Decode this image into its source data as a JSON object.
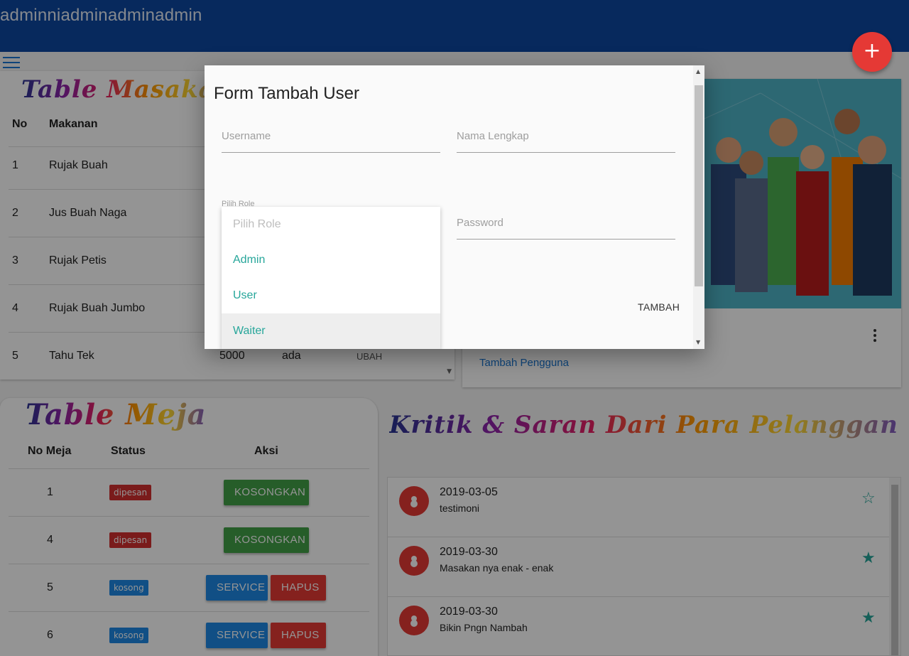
{
  "app": {
    "title": "adminniadminadminadmin"
  },
  "fab": {
    "label": "+"
  },
  "masakan": {
    "title": "Table Masakan",
    "headers": {
      "no": "No",
      "makanan": "Makanan"
    },
    "rows": [
      {
        "no": "1",
        "makanan": "Rujak Buah"
      },
      {
        "no": "2",
        "makanan": "Jus Buah Naga"
      },
      {
        "no": "3",
        "makanan": "Rujak Petis"
      },
      {
        "no": "4",
        "makanan": "Rujak Buah Jumbo"
      },
      {
        "no": "5",
        "makanan": "Tahu Tek",
        "harga": "5000",
        "status": "ada",
        "aksi": "UBAH"
      }
    ]
  },
  "people_card": {
    "link": "Tambah Pengguna"
  },
  "meja": {
    "title": "Table Meja",
    "headers": {
      "no": "No Meja",
      "status": "Status",
      "aksi": "Aksi"
    },
    "rows": [
      {
        "no": "1",
        "status": "dipesan",
        "action": "KOSONGKAN"
      },
      {
        "no": "4",
        "status": "dipesan",
        "action": "KOSONGKAN"
      },
      {
        "no": "5",
        "status": "kosong",
        "action": "SERVICE",
        "action2": "HAPUS"
      },
      {
        "no": "6",
        "status": "kosong",
        "action": "SERVICE",
        "action2": "HAPUS"
      }
    ]
  },
  "kritik": {
    "title": "Kritik & Saran Dari Para Pelanggan",
    "items": [
      {
        "date": "2019-03-05",
        "message": "testimoni",
        "star": "☆"
      },
      {
        "date": "2019-03-30",
        "message": "Masakan nya enak - enak",
        "star": "★"
      },
      {
        "date": "2019-03-30",
        "message": "Bikin Pngn Nambah",
        "star": "★"
      }
    ]
  },
  "modal": {
    "title": "Form Tambah User",
    "username_placeholder": "Username",
    "nama_placeholder": "Nama Lengkap",
    "role_label": "Pilih Role",
    "password_placeholder": "Password",
    "submit": "TAMBAH",
    "role_options": [
      "Pilih Role",
      "Admin",
      "User",
      "Waiter"
    ]
  },
  "colors": {
    "header": "#0d47a1",
    "fab": "#e53935",
    "accent": "#26a69a",
    "green": "#43a047",
    "blue": "#1e88e5",
    "red": "#e53935"
  }
}
